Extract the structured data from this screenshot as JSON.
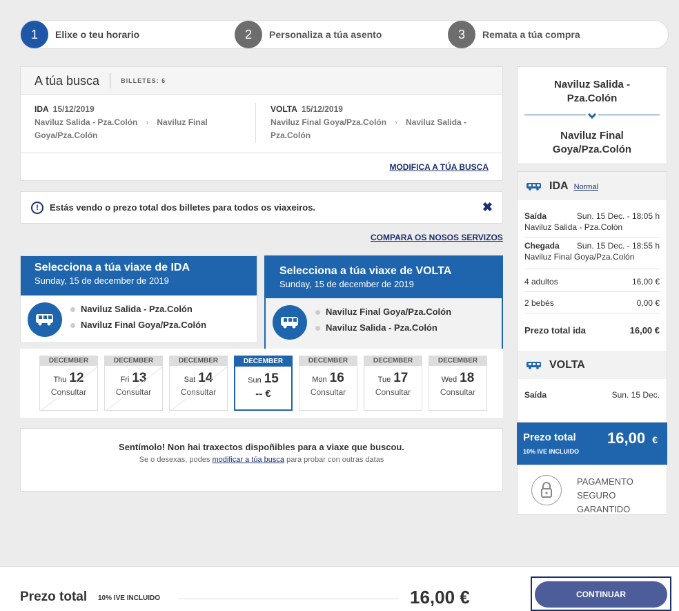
{
  "steps": [
    {
      "num": "1",
      "label": "Elixe o teu horario"
    },
    {
      "num": "2",
      "label": "Personaliza a túa asento"
    },
    {
      "num": "3",
      "label": "Remata a túa compra"
    }
  ],
  "search": {
    "title": "A túa busca",
    "tickets": "BILLETES: 6",
    "outbound": {
      "key": "IDA",
      "date": "15/12/2019",
      "from": "Naviluz Salida - Pza.Colón",
      "to_line1": "Naviluz Final",
      "to_line2": "Goya/Pza.Colón"
    },
    "return": {
      "key": "VOLTA",
      "date": "15/12/2019",
      "from": "Naviluz Final Goya/Pza.Colón",
      "to_line1": "Naviluz Salida -",
      "to_line2": "Pza.Colón"
    },
    "modify_link": "MODIFICA A TÚA BUSCA"
  },
  "notice": {
    "text": "Estás vendo o prezo total dos billetes para todos os viaxeiros.",
    "close": "✖"
  },
  "compare_link": "COMPARA OS NOSOS SERVIZOS",
  "ida_card": {
    "title": "Selecciona a túa viaxe de IDA",
    "date": "Sunday, 15 de december de 2019",
    "from": "Naviluz Salida - Pza.Colón",
    "to": "Naviluz Final Goya/Pza.Colón"
  },
  "volta_card": {
    "title": "Selecciona a túa viaxe de VOLTA",
    "date": "Sunday, 15 de december de 2019",
    "from": "Naviluz Final Goya/Pza.Colón",
    "to": "Naviluz Salida - Pza.Colón"
  },
  "dates": [
    {
      "month": "DECEMBER",
      "dow": "Thu",
      "day": "12",
      "text": "Consultar"
    },
    {
      "month": "DECEMBER",
      "dow": "Fri",
      "day": "13",
      "text": "Consultar"
    },
    {
      "month": "DECEMBER",
      "dow": "Sat",
      "day": "14",
      "text": "Consultar"
    },
    {
      "month": "DECEMBER",
      "dow": "Sun",
      "day": "15",
      "text": "-- €"
    },
    {
      "month": "DECEMBER",
      "dow": "Mon",
      "day": "16",
      "text": "Consultar"
    },
    {
      "month": "DECEMBER",
      "dow": "Tue",
      "day": "17",
      "text": "Consultar"
    },
    {
      "month": "DECEMBER",
      "dow": "Wed",
      "day": "18",
      "text": "Consultar"
    }
  ],
  "noresult": {
    "title": "Sentímolo! Non hai traxectos dispoñibles para a viaxe que buscou.",
    "pre": "Se o desexas, podes",
    "link": "modificar a túa busca",
    "post": "para probar con outras datas"
  },
  "route": {
    "from_l1": "Naviluz Salida -",
    "from_l2": "Pza.Colón",
    "to_l1": "Naviluz Final",
    "to_l2": "Goya/Pza.Colón"
  },
  "summary": {
    "ida_label": "IDA",
    "ida_class": "Normal",
    "saida_label": "Saída",
    "saida_time": "Sun. 15 Dec. - 18:05 h",
    "saida_place": "Naviluz Salida - Pza.Colón",
    "chegada_label": "Chegada",
    "chegada_time": "Sun. 15 Dec. - 18:55 h",
    "chegada_place": "Naviluz Final Goya/Pza.Colón",
    "adults": "4 adultos",
    "adults_price": "16,00 €",
    "babies": "2 bebés",
    "babies_price": "0,00 €",
    "total_ida_label": "Prezo total ida",
    "total_ida": "16,00 €",
    "volta_label": "VOLTA",
    "volta_saida_label": "Saída",
    "volta_saida_date": "Sun. 15 Dec."
  },
  "total_box": {
    "label": "Prezo total",
    "vat": "10% IVE INCLUIDO",
    "amount": "16,00",
    "currency": "€"
  },
  "secure": {
    "l1": "PAGAMENTO",
    "l2": "SEGURO",
    "l3": "GARANTIDO"
  },
  "bottom": {
    "label": "Prezo total",
    "vat": "10% IVE INCLUIDO",
    "amount": "16,00 €",
    "button": "CONTINUAR"
  },
  "colors": {
    "primary": "#1f65ae",
    "dark": "#1b2f6e",
    "button": "#4c5d9a"
  }
}
